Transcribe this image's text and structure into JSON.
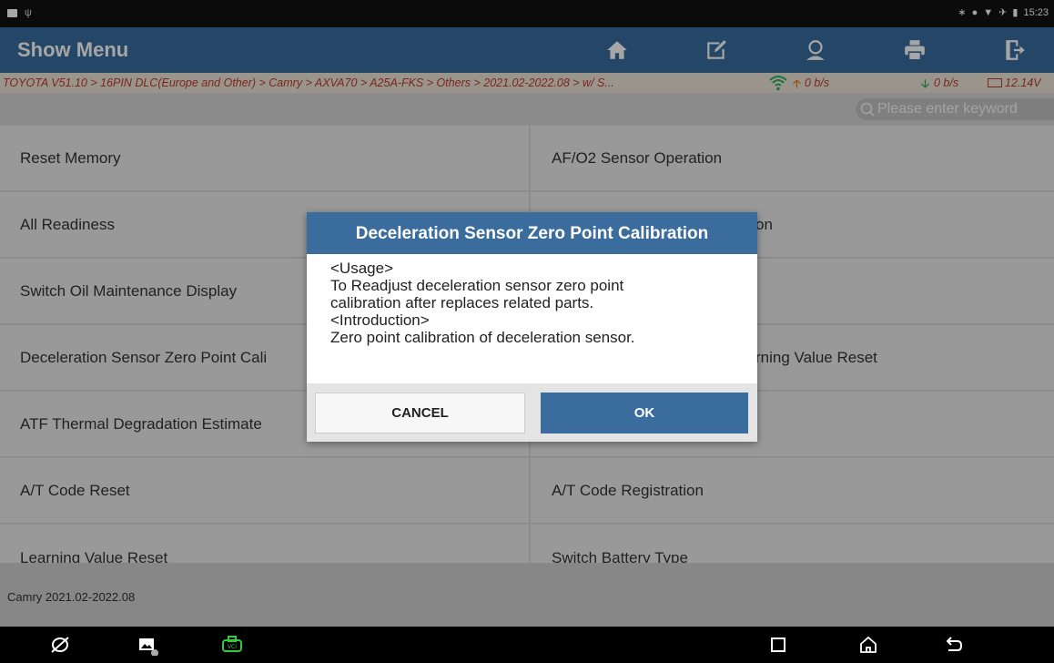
{
  "status": {
    "time": "15:23"
  },
  "header": {
    "title": "Show Menu",
    "icons": [
      "home-icon",
      "edit-report-icon",
      "user-icon",
      "print-icon",
      "exit-icon"
    ]
  },
  "breadcrumb": {
    "path": "TOYOTA V51.10 > 16PIN DLC(Europe and Other) > Camry > AXVA70 > A25A-FKS > Others > 2021.02-2022.08 > w/ S...",
    "upload_rate": "0 b/s",
    "download_rate": "0 b/s",
    "voltage": "12.14V"
  },
  "search": {
    "placeholder": "Please enter keyword"
  },
  "menu": {
    "left": [
      "Reset Memory",
      "All Readiness",
      "Switch Oil Maintenance Display",
      "Deceleration Sensor Zero Point Cali",
      "ATF Thermal Degradation Estimate",
      "A/T Code Reset",
      "Learning Value Reset"
    ],
    "right": [
      "AF/O2 Sensor Operation",
      "on",
      "",
      "rning Value Reset",
      "",
      "A/T Code Registration",
      "Switch Battery Type"
    ]
  },
  "footer": {
    "vehicle": "Camry 2021.02-2022.08"
  },
  "dialog": {
    "title": "Deceleration Sensor Zero Point Calibration",
    "lines": [
      "<Usage>",
      "To Readjust deceleration sensor zero point",
      "calibration after replaces related parts.",
      "<Introduction>",
      "Zero point calibration of deceleration sensor."
    ],
    "cancel_label": "CANCEL",
    "ok_label": "OK"
  },
  "colors": {
    "header": "#3a6d9e",
    "breadcrumb_text": "#c0392b",
    "upload_arrow": "#e67e22",
    "download_arrow": "#27ae60",
    "vci_icon": "#2ecc40"
  }
}
